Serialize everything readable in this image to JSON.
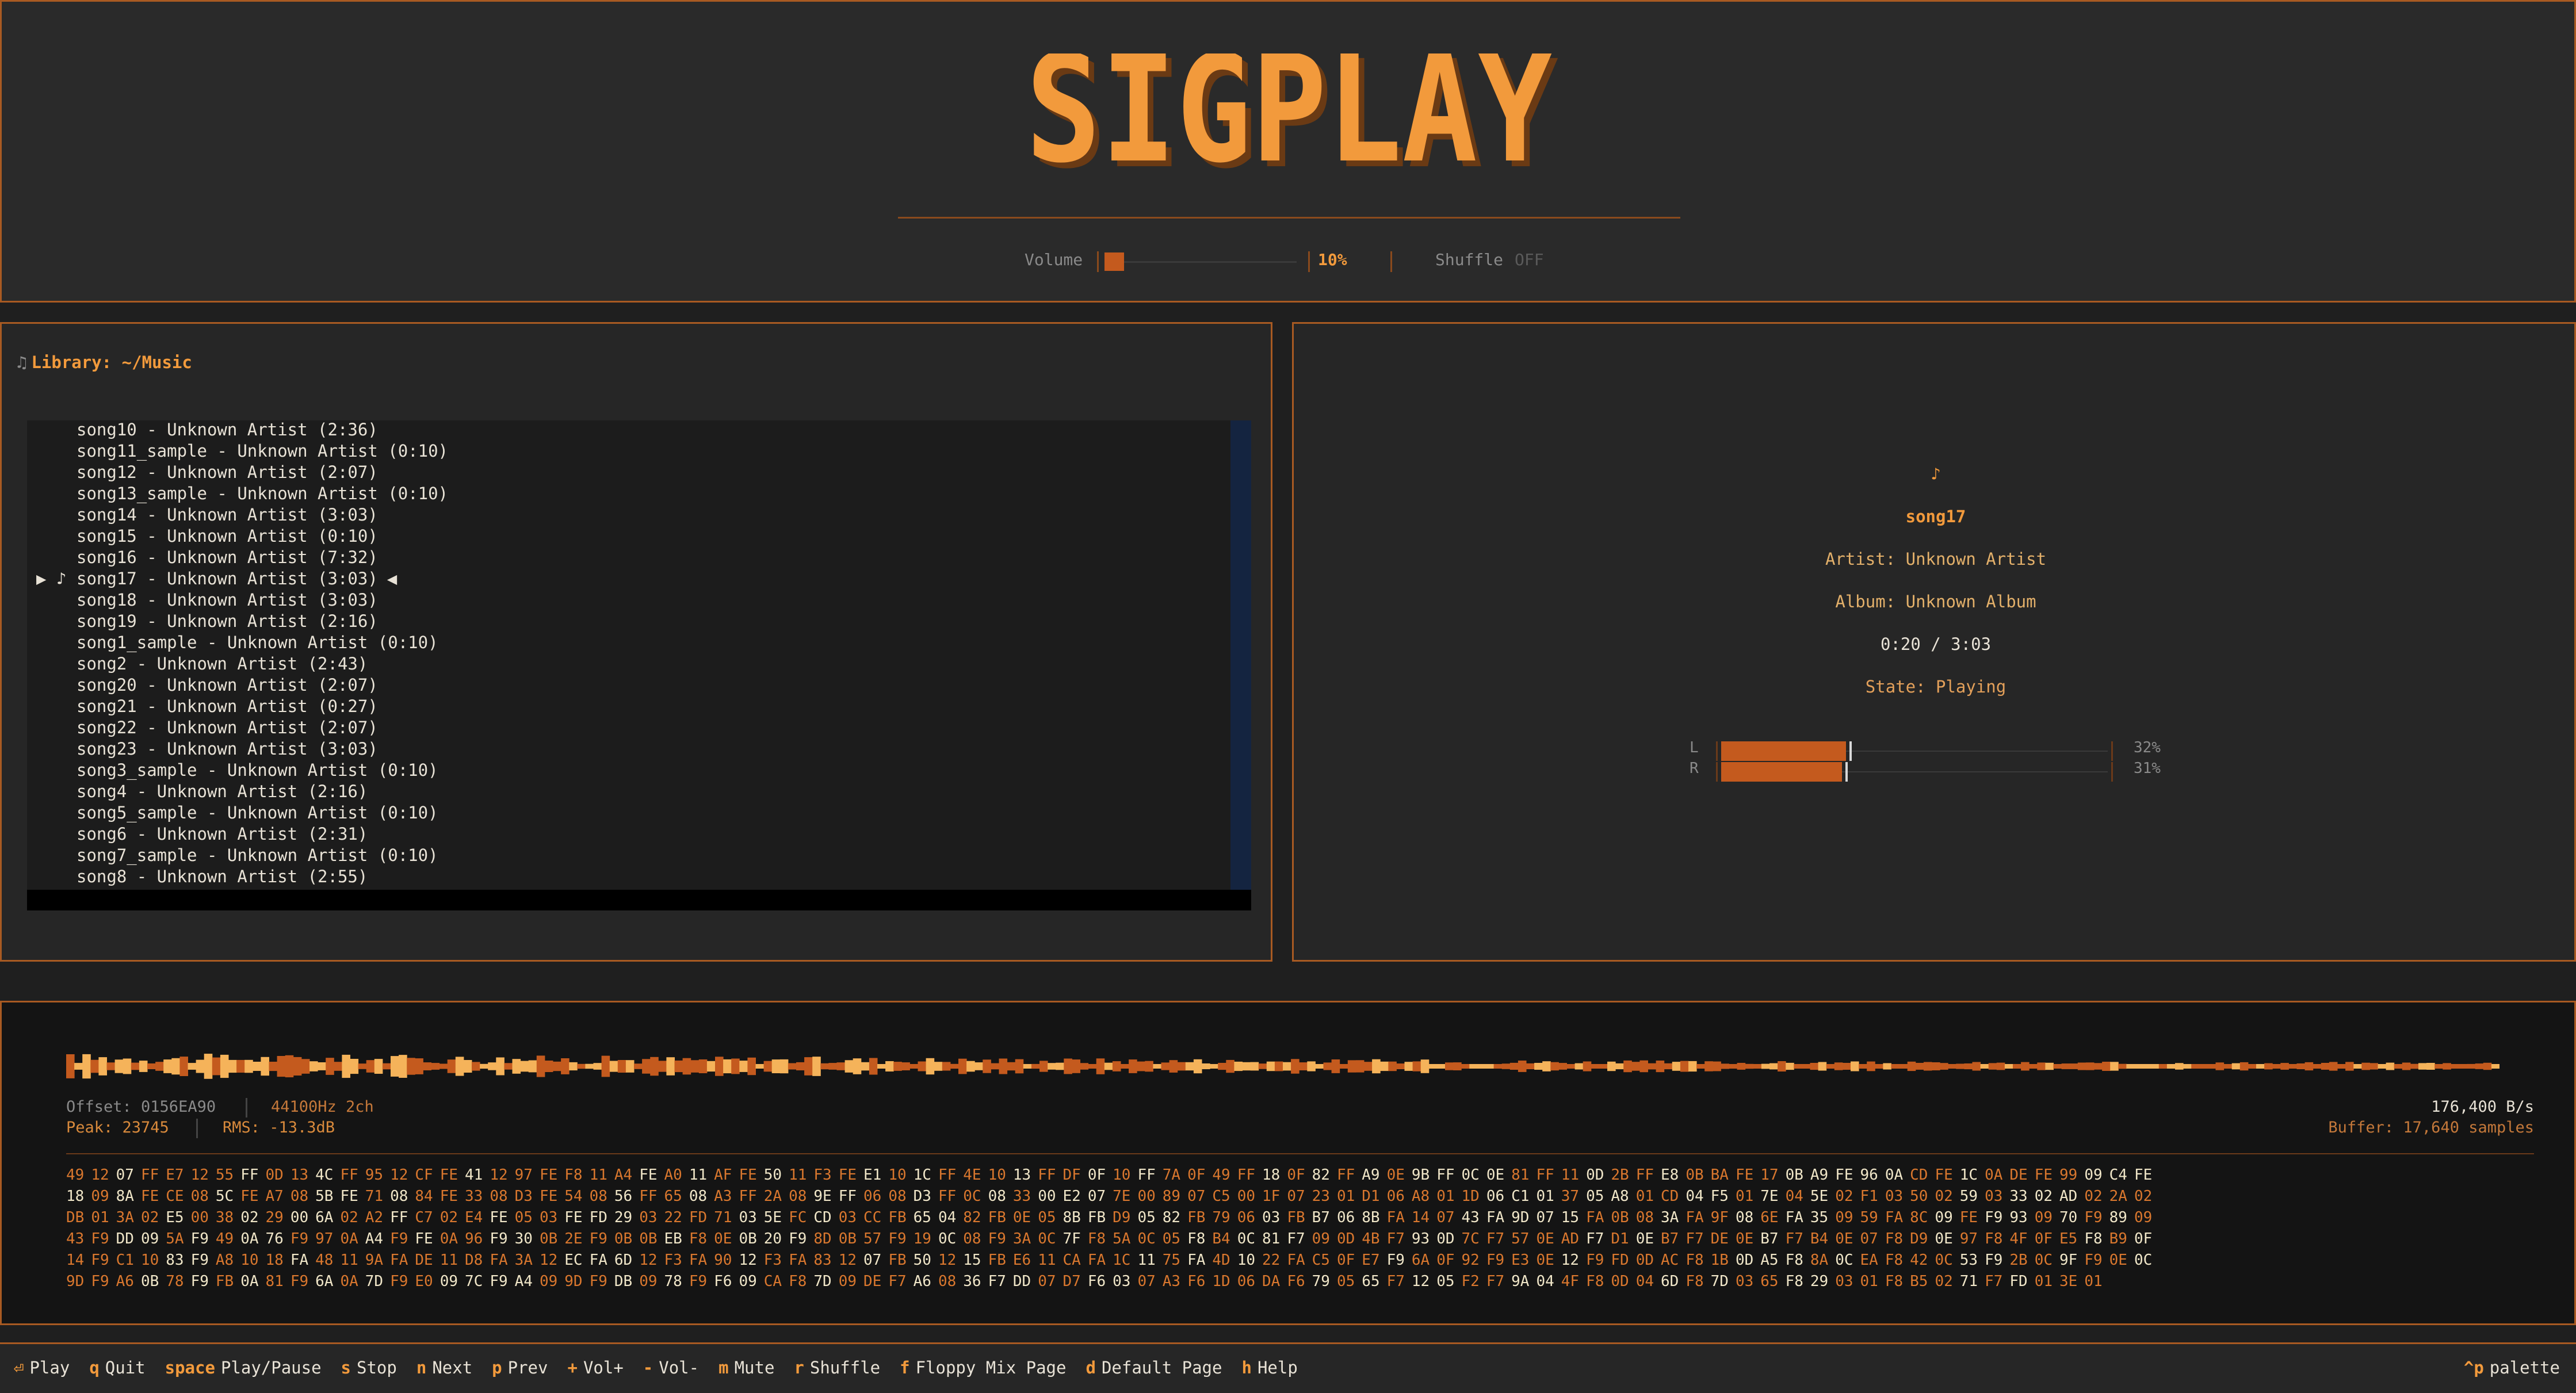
{
  "header": {
    "logo_text": "SIGPLAY",
    "volume_label": "Volume",
    "volume_value": 0.1,
    "volume_pct": "10%",
    "shuffle_label": "Shuffle",
    "shuffle_value": "OFF"
  },
  "library": {
    "icon": "music-note-icon",
    "title": "Library: ~/Music",
    "playing_marker_left": "▶ ♪",
    "playing_marker_right": "◀",
    "items": [
      "song10 - Unknown Artist (2:36)",
      "song11_sample - Unknown Artist (0:10)",
      "song12 - Unknown Artist (2:07)",
      "song13_sample - Unknown Artist (0:10)",
      "song14 - Unknown Artist (3:03)",
      "song15 - Unknown Artist (0:10)",
      "song16 - Unknown Artist (7:32)",
      "song17 - Unknown Artist (3:03)",
      "song18 - Unknown Artist (3:03)",
      "song19 - Unknown Artist (2:16)",
      "song1_sample - Unknown Artist (0:10)",
      "song2 - Unknown Artist (2:43)",
      "song20 - Unknown Artist (2:07)",
      "song21 - Unknown Artist (0:27)",
      "song22 - Unknown Artist (2:07)",
      "song23 - Unknown Artist (3:03)",
      "song3_sample - Unknown Artist (0:10)",
      "song4 - Unknown Artist (2:16)",
      "song5_sample - Unknown Artist (0:10)",
      "song6 - Unknown Artist (2:31)",
      "song7_sample - Unknown Artist (0:10)",
      "song8 - Unknown Artist (2:55)"
    ],
    "playing_index": 7
  },
  "now_playing": {
    "note": "♪",
    "title": "song17",
    "artist": "Artist: Unknown Artist",
    "album": "Album: Unknown Album",
    "time": "0:20 / 3:03",
    "state": "State: Playing",
    "left_label": "L",
    "right_label": "R",
    "left_level": 0.32,
    "right_level": 0.31,
    "left_pct": "32%",
    "right_pct": "31%"
  },
  "visualizer": {
    "offset": "Offset: 0156EA90",
    "format": "44100Hz 2ch",
    "peak": "Peak: 23745",
    "rms": "RMS: -13.3dB",
    "rate": "176,400 B/s",
    "buffer": "Buffer: 17,640 samples",
    "hex_rows": [
      "49 12 07 FF E7 12 55 FF 0D 13 4C FF 95 12 CF FE 41 12 97 FE F8 11 A4 FE A0 11 AF FE 50 11 F3 FE E1 10 1C FF 4E 10 13 FF DF 0F 10 FF 7A 0F 49 FF 18 0F 82 FF A9 0E 9B FF 0C 0E 81 FF 11 0D 2B FF E8 0B BA FE 17 0B A9 FE 96 0A CD FE 1C 0A DE FE 99 09 C4 FE",
      "18 09 8A FE CE 08 5C FE A7 08 5B FE 71 08 84 FE 33 08 D3 FE 54 08 56 FF 65 08 A3 FF 2A 08 9E FF 06 08 D3 FF 0C 08 33 00 E2 07 7E 00 89 07 C5 00 1F 07 23 01 D1 06 A8 01 1D 06 C1 01 37 05 A8 01 CD 04 F5 01 7E 04 5E 02 F1 03 50 02 59 03 33 02 AD 02 2A 02",
      "DB 01 3A 02 E5 00 38 02 29 00 6A 02 A2 FF C7 02 E4 FE 05 03 FE FD 29 03 22 FD 71 03 5E FC CD 03 CC FB 65 04 82 FB 0E 05 8B FB D9 05 82 FB 79 06 03 FB B7 06 8B FA 14 07 43 FA 9D 07 15 FA 0B 08 3A FA 9F 08 6E FA 35 09 59 FA 8C 09 FE F9 93 09 70 F9 89 09",
      "43 F9 DD 09 5A F9 49 0A 76 F9 97 0A A4 F9 FE 0A 96 F9 30 0B 2E F9 0B 0B EB F8 0E 0B 20 F9 8D 0B 57 F9 19 0C 08 F9 3A 0C 7F F8 5A 0C 05 F8 B4 0C 81 F7 09 0D 4B F7 93 0D 7C F7 57 0E AD F7 D1 0E B7 F7 DE 0E B7 F7 B4 0E 07 F8 D9 0E 97 F8 4F 0F E5 F8 B9 0F",
      "14 F9 C1 10 83 F9 A8 10 18 FA 48 11 9A FA DE 11 D8 FA 3A 12 EC FA 6D 12 F3 FA 90 12 F3 FA 83 12 07 FB 50 12 15 FB E6 11 CA FA 1C 11 75 FA 4D 10 22 FA C5 0F E7 F9 6A 0F 92 F9 E3 0E 12 F9 FD 0D AC F8 1B 0D A5 F8 8A 0C EA F8 42 0C 53 F9 2B 0C 9F F9 0E 0C",
      "9D F9 A6 0B 78 F9 FB 0A 81 F9 6A 0A 7D F9 E0 09 7C F9 A4 09 9D F9 DB 09 78 F9 F6 09 CA F8 7D 09 DE F7 A6 08 36 F7 DD 07 D7 F6 03 07 A3 F6 1D 06 DA F6 79 05 65 F7 12 05 F2 F7 9A 04 4F F8 0D 04 6D F8 7D 03 65 F8 29 03 01 F8 B5 02 71 F7 FD 01 3E 01"
    ]
  },
  "footer": {
    "keys": [
      {
        "key": "⏎",
        "label": "Play"
      },
      {
        "key": "q",
        "label": "Quit"
      },
      {
        "key": "space",
        "label": "Play/Pause"
      },
      {
        "key": "s",
        "label": "Stop"
      },
      {
        "key": "n",
        "label": "Next"
      },
      {
        "key": "p",
        "label": "Prev"
      },
      {
        "key": "+",
        "label": "Vol+"
      },
      {
        "key": "-",
        "label": "Vol-"
      },
      {
        "key": "m",
        "label": "Mute"
      },
      {
        "key": "r",
        "label": "Shuffle"
      },
      {
        "key": "f",
        "label": "Floppy Mix Page"
      },
      {
        "key": "d",
        "label": "Default Page"
      },
      {
        "key": "h",
        "label": "Help"
      }
    ],
    "palette_key": "^p",
    "palette_label": "palette"
  },
  "colors": {
    "accent": "#f29a3c",
    "accent_dark": "#c45a1e",
    "border": "#a85a22",
    "hex_bright": "#f0e6c8",
    "hex_dim": "#d9772e",
    "scrollbar": "#142440"
  }
}
